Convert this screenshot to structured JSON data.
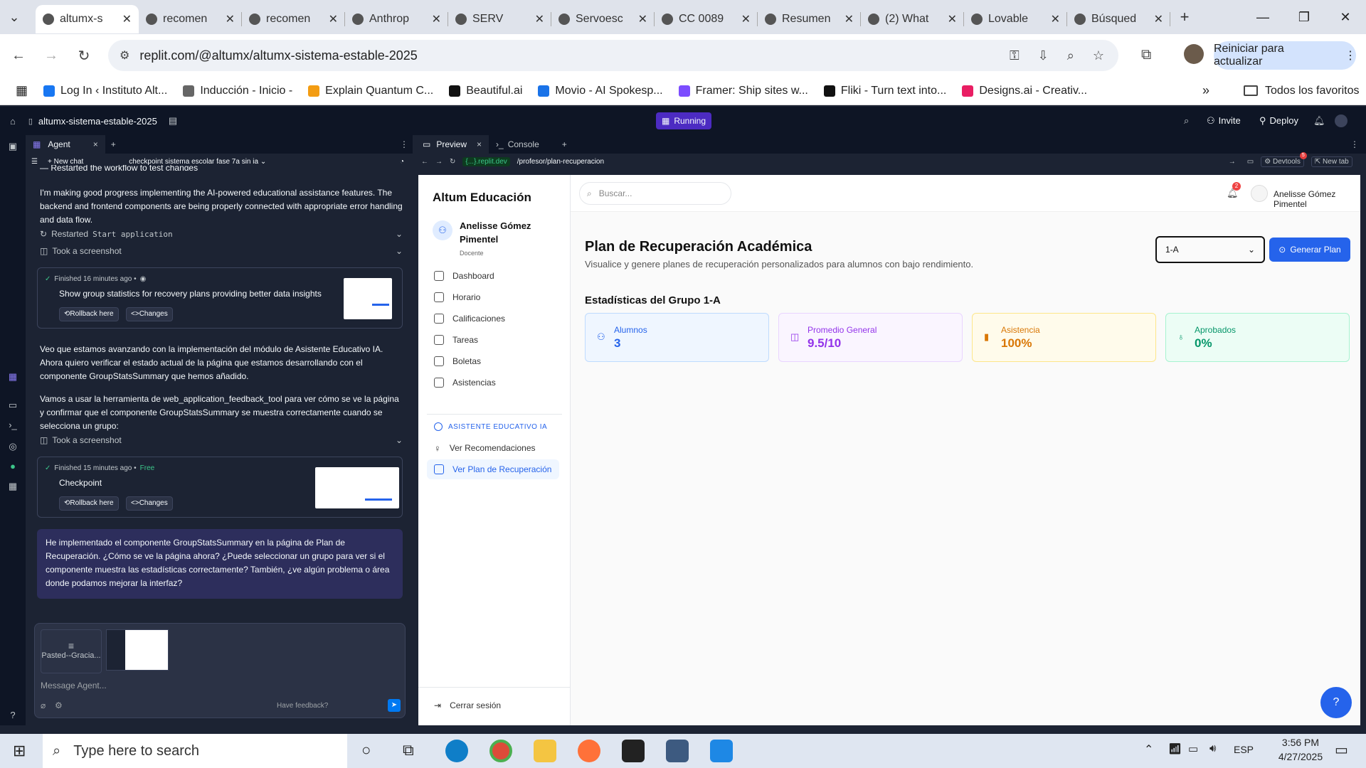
{
  "browser": {
    "tabs": [
      {
        "title": "altumx-s",
        "active": true,
        "icon": "replit-icon"
      },
      {
        "title": "recomen",
        "icon": "globe-icon"
      },
      {
        "title": "recomen",
        "icon": "globe-icon"
      },
      {
        "title": "Anthrop",
        "icon": "anthropic-icon"
      },
      {
        "title": "SERV",
        "icon": "doc-icon"
      },
      {
        "title": "Servoesc",
        "icon": "app-icon"
      },
      {
        "title": "CC 0089",
        "icon": "globe-icon"
      },
      {
        "title": "Resumen",
        "icon": "openai-icon"
      },
      {
        "title": "(2) What",
        "icon": "whatsapp-icon"
      },
      {
        "title": "Lovable",
        "icon": "openai-icon"
      },
      {
        "title": "Búsqued",
        "icon": "perplexity-icon"
      }
    ],
    "url": "replit.com/@altumx/altumx-sistema-estable-2025",
    "update_button": "Reiniciar para actualizar",
    "bookmarks": [
      "Log In ‹ Instituto Alt...",
      "Inducción - Inicio -",
      "Explain Quantum C...",
      "Beautiful.ai",
      "Movio - AI Spokesp...",
      "Framer: Ship sites w...",
      "Fliki - Turn text into...",
      "Designs.ai - Creativ..."
    ],
    "all_bookmarks": "Todos los favoritos"
  },
  "replit": {
    "repl_name": "altumx-sistema-estable-2025",
    "status": "Running",
    "invite": "Invite",
    "deploy": "Deploy",
    "agent_tab": "Agent",
    "new_chat": "New chat",
    "chat_title": "checkpoint sistema escolar fase 7a sin ia",
    "messages": {
      "cut_top": "— Restarted the workflow to test changes",
      "m1": "I'm making good progress implementing the AI-powered educational assistance features. The backend and frontend components are being properly connected with appropriate error handling and data flow.",
      "restarted": "Restarted",
      "restarted_code": "Start application",
      "screenshot1": "Took a screenshot",
      "card1_meta": "Finished 16 minutes ago •",
      "card1_title": "Show group statistics for recovery plans providing better data insights",
      "rollback": "Rollback here",
      "changes": "Changes",
      "m2": "Veo que estamos avanzando con la implementación del módulo de Asistente Educativo IA. Ahora quiero verificar el estado actual de la página que estamos desarrollando con el componente GroupStatsSummary que hemos añadido.",
      "m3": "Vamos a usar la herramienta de web_application_feedback_tool para ver cómo se ve la página y confirmar que el componente GroupStatsSummary se muestra correctamente cuando se selecciona un grupo:",
      "screenshot2": "Took a screenshot",
      "card2_meta": "Finished 15 minutes ago •",
      "card2_free": "Free",
      "card2_title": "Checkpoint",
      "user": "He implementado el componente GroupStatsSummary en la página de Plan de Recuperación. ¿Cómo se ve la página ahora? ¿Puede seleccionar un grupo para ver si el componente muestra las estadísticas correctamente? También, ¿ve algún problema o área donde podamos mejorar la interfaz?"
    },
    "attachment_label": "Pasted--Gracia...",
    "input_placeholder": "Message Agent...",
    "feedback": "Have feedback?",
    "preview_tab": "Preview",
    "console_tab": "Console",
    "preview_host": "{...}.replit.dev",
    "preview_path": "/profesor/plan-recuperacion",
    "devtools": "Devtools",
    "devtools_badge": "5",
    "new_tab": "New tab"
  },
  "app": {
    "brand": "Altum Educación",
    "search_placeholder": "Buscar...",
    "user_name": "Anelisse Gómez Pimentel",
    "user_role": "Docente",
    "notif_count": "2",
    "nav": [
      "Dashboard",
      "Horario",
      "Calificaciones",
      "Tareas",
      "Boletas",
      "Asistencias"
    ],
    "ai_section": "ASISTENTE EDUCATIVO IA",
    "ai_items": [
      "Ver Recomendaciones",
      "Ver Plan de Recuperación"
    ],
    "logout": "Cerrar sesión",
    "page_title": "Plan de Recuperación Académica",
    "page_subtitle": "Visualice y genere planes de recuperación personalizados para alumnos con bajo rendimiento.",
    "group_select": "1-A",
    "generate_button": "Generar Plan",
    "stats_title": "Estadísticas del Grupo 1-A",
    "stats": [
      {
        "label": "Alumnos",
        "value": "3",
        "color": "#2563eb",
        "bg": "#eff6ff",
        "border": "#bfdbfe",
        "icon": "users-icon"
      },
      {
        "label": "Promedio General",
        "value": "9.5/10",
        "color": "#9333ea",
        "bg": "#faf5ff",
        "border": "#e9d5ff",
        "icon": "book-icon"
      },
      {
        "label": "Asistencia",
        "value": "100%",
        "color": "#d97706",
        "bg": "#fffbeb",
        "border": "#fde68a",
        "icon": "bar-chart-icon"
      },
      {
        "label": "Aprobados",
        "value": "0%",
        "color": "#059669",
        "bg": "#ecfdf5",
        "border": "#a7f3d0",
        "icon": "award-icon"
      }
    ]
  },
  "taskbar": {
    "search": "Type here to search",
    "lang": "ESP",
    "time": "3:56 PM",
    "date": "4/27/2025"
  }
}
